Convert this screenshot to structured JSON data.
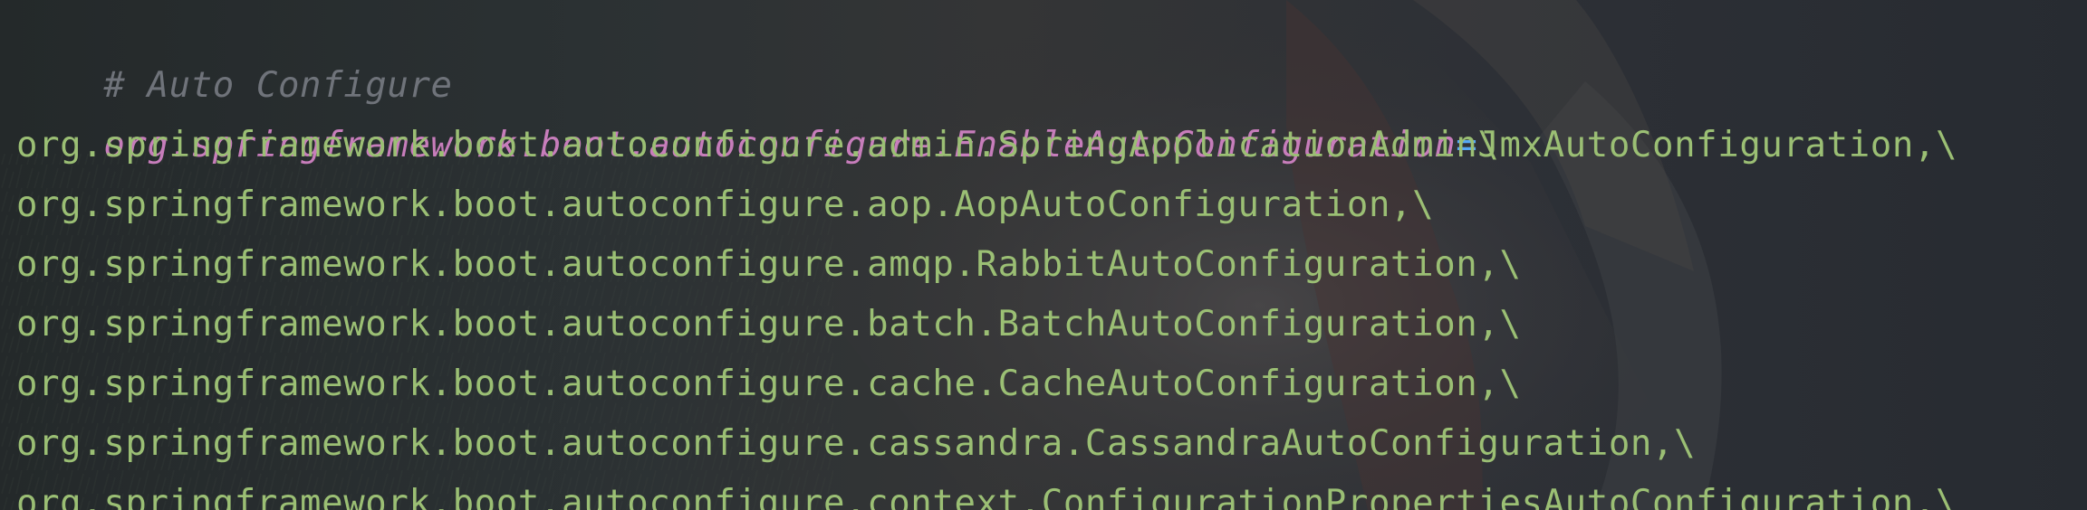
{
  "editor": {
    "comment": "# Auto Configure",
    "key": "org.springframework.boot.autoconfigure.EnableAutoConfiguration",
    "operator": "=",
    "continuation": "\\",
    "values": [
      "org.springframework.boot.autoconfigure.admin.SpringApplicationAdminJmxAutoConfiguration,\\",
      "org.springframework.boot.autoconfigure.aop.AopAutoConfiguration,\\",
      "org.springframework.boot.autoconfigure.amqp.RabbitAutoConfiguration,\\",
      "org.springframework.boot.autoconfigure.batch.BatchAutoConfiguration,\\",
      "org.springframework.boot.autoconfigure.cache.CacheAutoConfiguration,\\",
      "org.springframework.boot.autoconfigure.cassandra.CassandraAutoConfiguration,\\",
      "org.springframework.boot.autoconfigure.context.ConfigurationPropertiesAutoConfiguration,\\"
    ]
  },
  "colors": {
    "background": "#2a2d31",
    "comment": "#6f737a",
    "key": "#c77dbb",
    "operator": "#56a8f5",
    "value": "#9bbf74"
  }
}
